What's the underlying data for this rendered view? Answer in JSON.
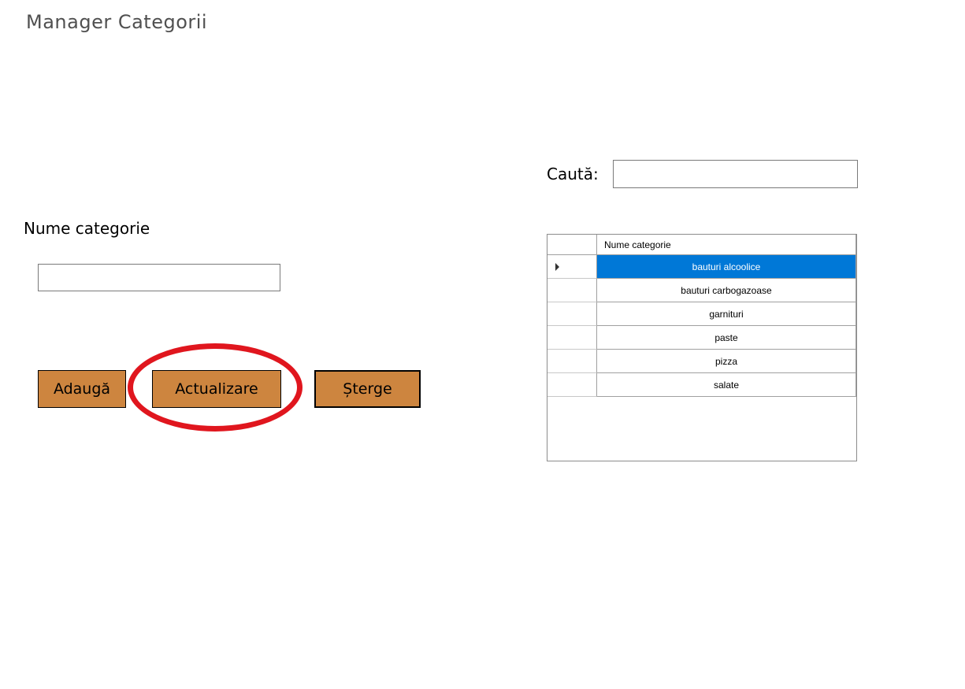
{
  "window": {
    "title": "Manager Categorii"
  },
  "form": {
    "name_label": "Nume categorie",
    "name_value": "",
    "name_placeholder": ""
  },
  "buttons": {
    "add": "Adaugă",
    "update": "Actualizare",
    "delete": "Șterge",
    "color": "#cd853f"
  },
  "annotation": {
    "highlighted": "update-button",
    "color": "#e0161e"
  },
  "search": {
    "label": "Caută:",
    "value": ""
  },
  "grid": {
    "column_header": "Nume categorie",
    "selected_index": 0,
    "selection_color": "#0078d7",
    "rows": [
      "bauturi alcoolice",
      "bauturi carbogazoase",
      "garnituri",
      "paste",
      "pizza",
      "salate"
    ]
  }
}
